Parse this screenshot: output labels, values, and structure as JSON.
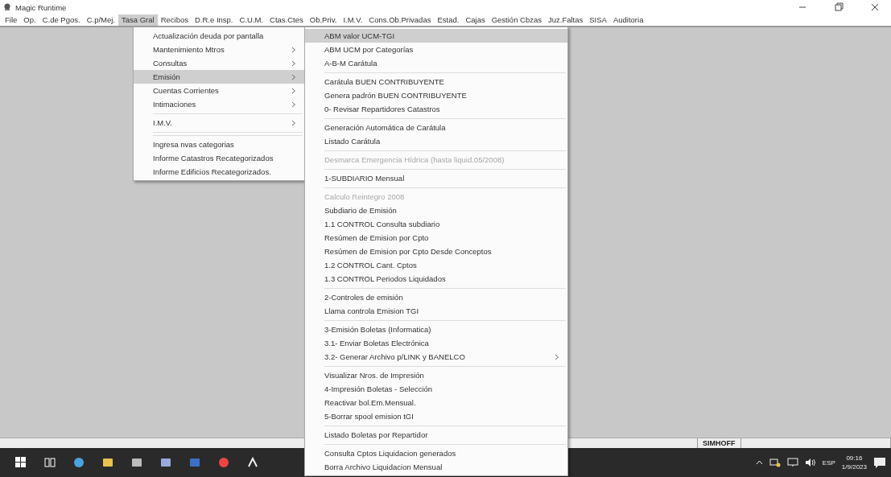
{
  "window": {
    "title": "Magic Runtime"
  },
  "menu_bar": [
    {
      "label": "File",
      "selected": false
    },
    {
      "label": "Op.",
      "selected": false
    },
    {
      "label": "C.de Pgos.",
      "selected": false
    },
    {
      "label": "C.p/Mej.",
      "selected": false
    },
    {
      "label": "Tasa Gral",
      "selected": true
    },
    {
      "label": "Recibos",
      "selected": false
    },
    {
      "label": "D.R.e Insp.",
      "selected": false
    },
    {
      "label": "C.U.M.",
      "selected": false
    },
    {
      "label": "Ctas.Ctes",
      "selected": false
    },
    {
      "label": "Ob.Priv.",
      "selected": false
    },
    {
      "label": "I.M.V.",
      "selected": false
    },
    {
      "label": "Cons.Ob.Privadas",
      "selected": false
    },
    {
      "label": "Estad.",
      "selected": false
    },
    {
      "label": "Cajas",
      "selected": false
    },
    {
      "label": "Gestión Cbzas",
      "selected": false
    },
    {
      "label": "Juz.Faltas",
      "selected": false
    },
    {
      "label": "SISA",
      "selected": false
    },
    {
      "label": "Auditoria",
      "selected": false
    }
  ],
  "menu": [
    {
      "kind": "item",
      "label": "Actualización deuda por pantalla",
      "submenu": false,
      "selected": false,
      "disabled": false
    },
    {
      "kind": "item",
      "label": "Mantenimiento Mtros",
      "submenu": true,
      "selected": false,
      "disabled": false
    },
    {
      "kind": "item",
      "label": "Consultas",
      "submenu": true,
      "selected": false,
      "disabled": false
    },
    {
      "kind": "item",
      "label": "Emisión",
      "submenu": true,
      "selected": true,
      "disabled": false
    },
    {
      "kind": "item",
      "label": "Cuentas Corrientes",
      "submenu": true,
      "selected": false,
      "disabled": false
    },
    {
      "kind": "item",
      "label": "Intimaciones",
      "submenu": true,
      "selected": false,
      "disabled": false
    },
    {
      "kind": "separator"
    },
    {
      "kind": "item",
      "label": "I.M.V.",
      "submenu": true,
      "selected": false,
      "disabled": false
    },
    {
      "kind": "separator"
    },
    {
      "kind": "separator"
    },
    {
      "kind": "item",
      "label": "Ingresa nvas categorias",
      "submenu": false,
      "selected": false,
      "disabled": false
    },
    {
      "kind": "item",
      "label": "Informe Catastros Recategorizados",
      "submenu": false,
      "selected": false,
      "disabled": false
    },
    {
      "kind": "item",
      "label": "Informe Edificios Recategorizados.",
      "submenu": false,
      "selected": false,
      "disabled": false
    }
  ],
  "submenu": [
    {
      "kind": "item",
      "label": "ABM valor UCM-TGI",
      "submenu": false,
      "selected": true,
      "disabled": false
    },
    {
      "kind": "item",
      "label": "ABM UCM por Categorías",
      "submenu": false,
      "selected": false,
      "disabled": false
    },
    {
      "kind": "item",
      "label": "A-B-M Carátula",
      "submenu": false,
      "selected": false,
      "disabled": false
    },
    {
      "kind": "separator"
    },
    {
      "kind": "item",
      "label": "Carátula BUEN CONTRIBUYENTE",
      "submenu": false,
      "selected": false,
      "disabled": false
    },
    {
      "kind": "item",
      "label": "Genera padrón BUEN CONTRIBUYENTE",
      "submenu": false,
      "selected": false,
      "disabled": false
    },
    {
      "kind": "item",
      "label": "0- Revisar Repartidores Catastros",
      "submenu": false,
      "selected": false,
      "disabled": false
    },
    {
      "kind": "separator"
    },
    {
      "kind": "item",
      "label": "Generación Automática de Carátula",
      "submenu": false,
      "selected": false,
      "disabled": false
    },
    {
      "kind": "item",
      "label": "Listado Carátula",
      "submenu": false,
      "selected": false,
      "disabled": false
    },
    {
      "kind": "separator"
    },
    {
      "kind": "item",
      "label": "Desmarca Emergencia Hídrica (hasta liquid.05/2008)",
      "submenu": false,
      "selected": false,
      "disabled": true
    },
    {
      "kind": "separator"
    },
    {
      "kind": "item",
      "label": "1-SUBDIARIO Mensual",
      "submenu": false,
      "selected": false,
      "disabled": false
    },
    {
      "kind": "separator"
    },
    {
      "kind": "item",
      "label": "Calculo Reintegro 2008",
      "submenu": false,
      "selected": false,
      "disabled": true
    },
    {
      "kind": "item",
      "label": "Subdiario de Emisión",
      "submenu": false,
      "selected": false,
      "disabled": false
    },
    {
      "kind": "item",
      "label": "1.1 CONTROL Consulta subdiario",
      "submenu": false,
      "selected": false,
      "disabled": false
    },
    {
      "kind": "item",
      "label": "Resúmen de Emision por Cpto",
      "submenu": false,
      "selected": false,
      "disabled": false
    },
    {
      "kind": "item",
      "label": "Resúmen de Emision por Cpto Desde Conceptos",
      "submenu": false,
      "selected": false,
      "disabled": false
    },
    {
      "kind": "item",
      "label": "1.2 CONTROL  Cant. Cptos",
      "submenu": false,
      "selected": false,
      "disabled": false
    },
    {
      "kind": "item",
      "label": "1.3 CONTROL  Periodos Liquidados",
      "submenu": false,
      "selected": false,
      "disabled": false
    },
    {
      "kind": "separator"
    },
    {
      "kind": "item",
      "label": "2-Controles de emisión",
      "submenu": false,
      "selected": false,
      "disabled": false
    },
    {
      "kind": "item",
      "label": "Llama controla Emision TGI",
      "submenu": false,
      "selected": false,
      "disabled": false
    },
    {
      "kind": "separator"
    },
    {
      "kind": "item",
      "label": "3-Emisión Boletas (Informatica)",
      "submenu": false,
      "selected": false,
      "disabled": false
    },
    {
      "kind": "item",
      "label": "3.1- Enviar Boletas Electrónica",
      "submenu": false,
      "selected": false,
      "disabled": false
    },
    {
      "kind": "item",
      "label": "3.2- Generar Archivo p/LINK y BANELCO",
      "submenu": true,
      "selected": false,
      "disabled": false
    },
    {
      "kind": "separator"
    },
    {
      "kind": "item",
      "label": "Visualizar Nros. de Impresión",
      "submenu": false,
      "selected": false,
      "disabled": false
    },
    {
      "kind": "item",
      "label": "4-Impresión Boletas - Selección",
      "submenu": false,
      "selected": false,
      "disabled": false
    },
    {
      "kind": "item",
      "label": "Reactivar bol.Em.Mensual.",
      "submenu": false,
      "selected": false,
      "disabled": false
    },
    {
      "kind": "item",
      "label": "5-Borrar spool emision tGI",
      "submenu": false,
      "selected": false,
      "disabled": false
    },
    {
      "kind": "separator"
    },
    {
      "kind": "item",
      "label": "Listado Boletas por Repartidor",
      "submenu": false,
      "selected": false,
      "disabled": false
    },
    {
      "kind": "separator"
    },
    {
      "kind": "item",
      "label": "Consulta Cptos Liquidacion generados",
      "submenu": false,
      "selected": false,
      "disabled": false
    },
    {
      "kind": "item",
      "label": "Borra Archivo Liquidacion Mensual",
      "submenu": false,
      "selected": false,
      "disabled": false
    }
  ],
  "status_bar": {
    "user": "SIMHOFF"
  },
  "taskbar": {
    "language": "ESP",
    "time": "09:16",
    "date": "1/9/2023"
  }
}
